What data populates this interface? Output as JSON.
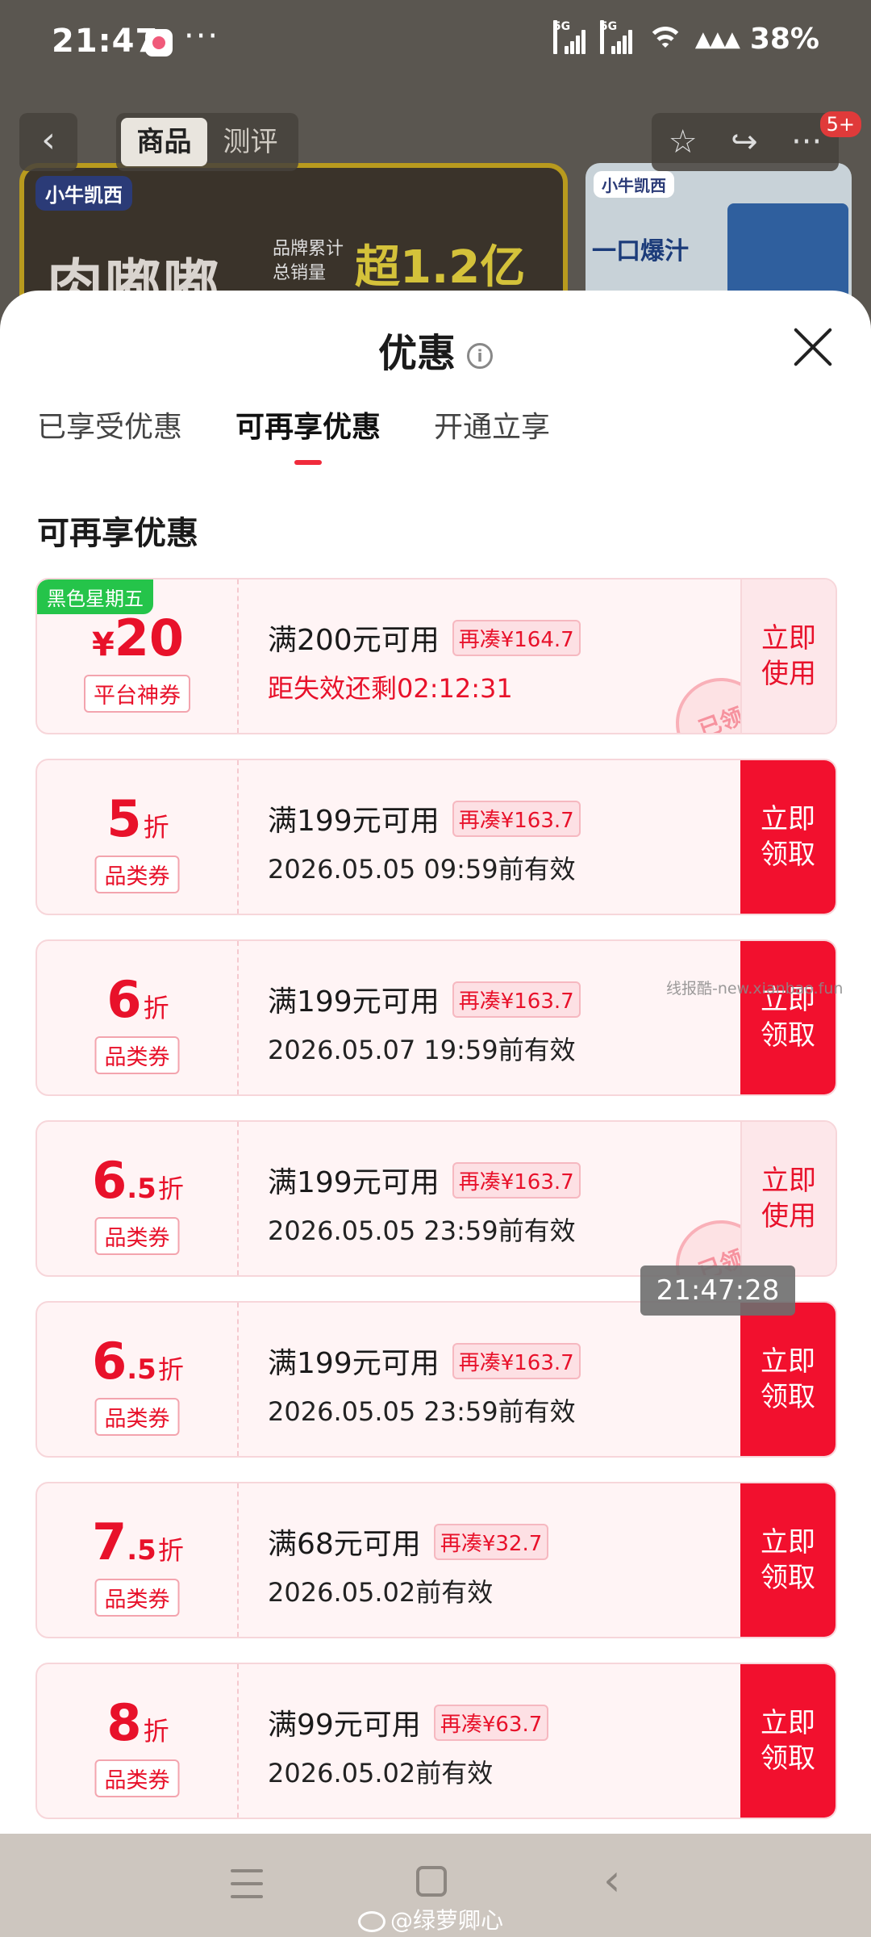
{
  "status_bar": {
    "time": "21:47",
    "dots": "···",
    "signal1_label": "5G",
    "signal2_label": "5G",
    "extra_icons": "▲▲▲",
    "battery": "38%"
  },
  "background_page": {
    "back_glyph": "‹",
    "tabs": [
      {
        "label": "商品"
      },
      {
        "label": "测评"
      }
    ],
    "badge": "5+",
    "banner1": {
      "brand": "小牛凯西",
      "headline": "肉嘟嘟",
      "subtext1": "品牌累计",
      "subtext2": "总销量",
      "highlight": "超1.2亿"
    },
    "banner2": {
      "brand": "小牛凯西",
      "headline": "一口爆汁"
    }
  },
  "sheet": {
    "title": "优惠",
    "info_glyph": "i",
    "tabs": [
      {
        "label": "已享受优惠"
      },
      {
        "label": "可再享优惠"
      },
      {
        "label": "开通立享"
      }
    ],
    "section_title": "可再享优惠",
    "coupons": [
      {
        "tag": "黑色星期五",
        "yen": "¥",
        "num": "20",
        "dec": "",
        "unit": "",
        "type": "平台神券",
        "condition": "满200元可用",
        "topup": "再凑¥164.7",
        "expiry": "距失效还剩02:12:31",
        "button": "立即使用",
        "stamp": "已领"
      },
      {
        "tag": "",
        "yen": "",
        "num": "5",
        "dec": "",
        "unit": "折",
        "type": "品类券",
        "condition": "满199元可用",
        "topup": "再凑¥163.7",
        "expiry": "2026.05.05 09:59前有效",
        "button": "立即领取",
        "stamp": ""
      },
      {
        "tag": "",
        "yen": "",
        "num": "6",
        "dec": "",
        "unit": "折",
        "type": "品类券",
        "condition": "满199元可用",
        "topup": "再凑¥163.7",
        "expiry": "2026.05.07 19:59前有效",
        "button": "立即领取",
        "stamp": ""
      },
      {
        "tag": "",
        "yen": "",
        "num": "6",
        "dec": ".5",
        "unit": "折",
        "type": "品类券",
        "condition": "满199元可用",
        "topup": "再凑¥163.7",
        "expiry": "2026.05.05 23:59前有效",
        "button": "立即使用",
        "stamp": "已领"
      },
      {
        "tag": "",
        "yen": "",
        "num": "6",
        "dec": ".5",
        "unit": "折",
        "type": "品类券",
        "condition": "满199元可用",
        "topup": "再凑¥163.7",
        "expiry": "2026.05.05 23:59前有效",
        "button": "立即领取",
        "stamp": ""
      },
      {
        "tag": "",
        "yen": "",
        "num": "7",
        "dec": ".5",
        "unit": "折",
        "type": "品类券",
        "condition": "满68元可用",
        "topup": "再凑¥32.7",
        "expiry": "2026.05.02前有效",
        "button": "立即领取",
        "stamp": ""
      },
      {
        "tag": "",
        "yen": "",
        "num": "8",
        "dec": "",
        "unit": "折",
        "type": "品类券",
        "condition": "满99元可用",
        "topup": "再凑¥63.7",
        "expiry": "2026.05.02前有效",
        "button": "立即领取",
        "stamp": ""
      }
    ]
  },
  "overlays": {
    "watermark": "线报酷-new.xianbao.fun",
    "clock_toast": "21:47:28",
    "weibo_handle": "@绿萝卿心"
  },
  "colors": {
    "accent_red": "#f2102e",
    "coupon_bg": "#fff4f5",
    "tag_green": "#25c44a"
  }
}
